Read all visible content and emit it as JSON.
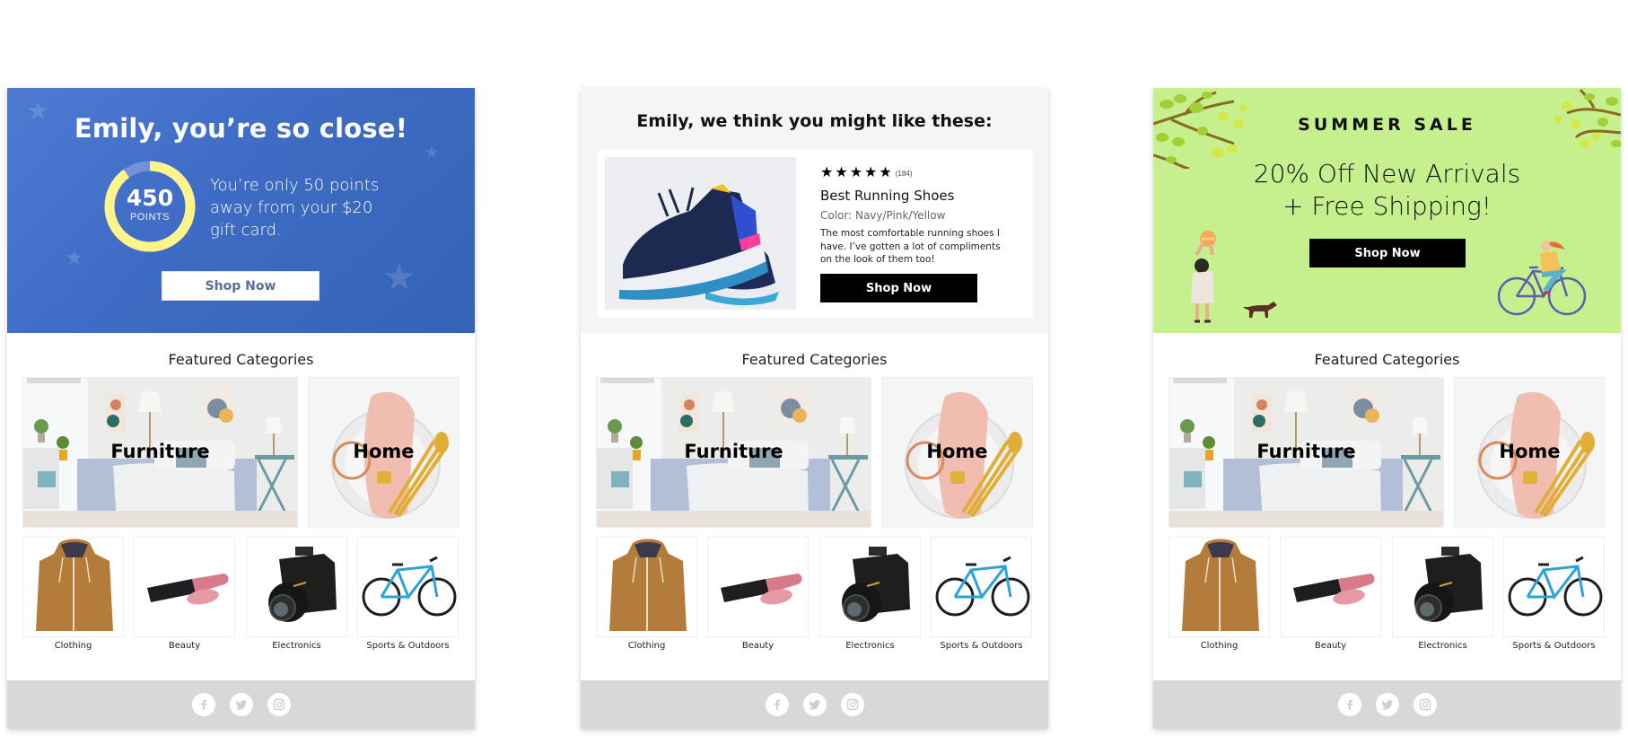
{
  "cards": [
    {
      "variant": "loyalty",
      "hero": {
        "title": "Emily, you’re so close!",
        "points_value": "450",
        "points_label": "POINTS",
        "points_progress": 0.9,
        "message": "You’re only 50 points away from your $20 gift card.",
        "cta": "Shop Now",
        "background": "#3e6cc4",
        "ring_color": "#fff48c"
      }
    },
    {
      "variant": "recommendation",
      "hero": {
        "title": "Emily, we think you might like these:",
        "rating_stars": 5,
        "review_count": "(184)",
        "product_name": "Best Running Shoes",
        "product_color": "Color: Navy/Pink/Yellow",
        "review_text": "The most comfortable running shoes I have. I’ve gotten a lot of compliments on the look of them too!",
        "cta": "Shop Now",
        "background": "#f5f5f5"
      }
    },
    {
      "variant": "promo",
      "hero": {
        "kicker": "SUMMER SALE",
        "headline_line1": "20% Off New Arrivals",
        "headline_line2": "+ Free Shipping!",
        "cta": "Shop Now",
        "background": "#c6f08e"
      }
    }
  ],
  "featured": {
    "title": "Featured Categories",
    "big": [
      {
        "label": "Furniture"
      },
      {
        "label": "Home"
      }
    ],
    "small": [
      {
        "label": "Clothing"
      },
      {
        "label": "Beauty"
      },
      {
        "label": "Electronics"
      },
      {
        "label": "Sports & Outdoors"
      }
    ]
  },
  "footer": {
    "social": [
      "facebook-icon",
      "twitter-icon",
      "instagram-icon"
    ]
  }
}
